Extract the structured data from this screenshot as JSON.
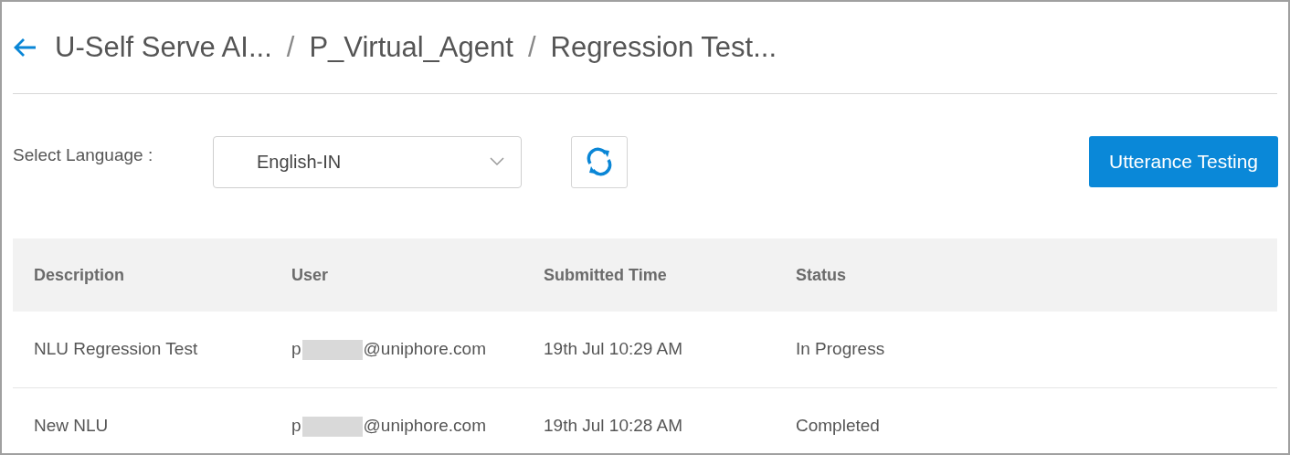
{
  "breadcrumb": [
    "U-Self Serve AI...",
    "P_Virtual_Agent",
    "Regression Test..."
  ],
  "separator": "/",
  "language": {
    "label": "Select Language :",
    "value": "English-IN"
  },
  "primary_button": "Utterance Testing",
  "table": {
    "columns": [
      "Description",
      "User",
      "Submitted Time",
      "Status"
    ],
    "rows": [
      {
        "description": "NLU Regression Test",
        "user_start": "p",
        "user_end": "@uniphore.com",
        "redacted": true,
        "time": "19th Jul 10:29 AM",
        "status": "In Progress"
      },
      {
        "description": "New NLU",
        "user_start": "p",
        "user_end": "@uniphore.com",
        "redacted": true,
        "time": "19th Jul 10:28 AM",
        "status": "Completed"
      }
    ]
  }
}
